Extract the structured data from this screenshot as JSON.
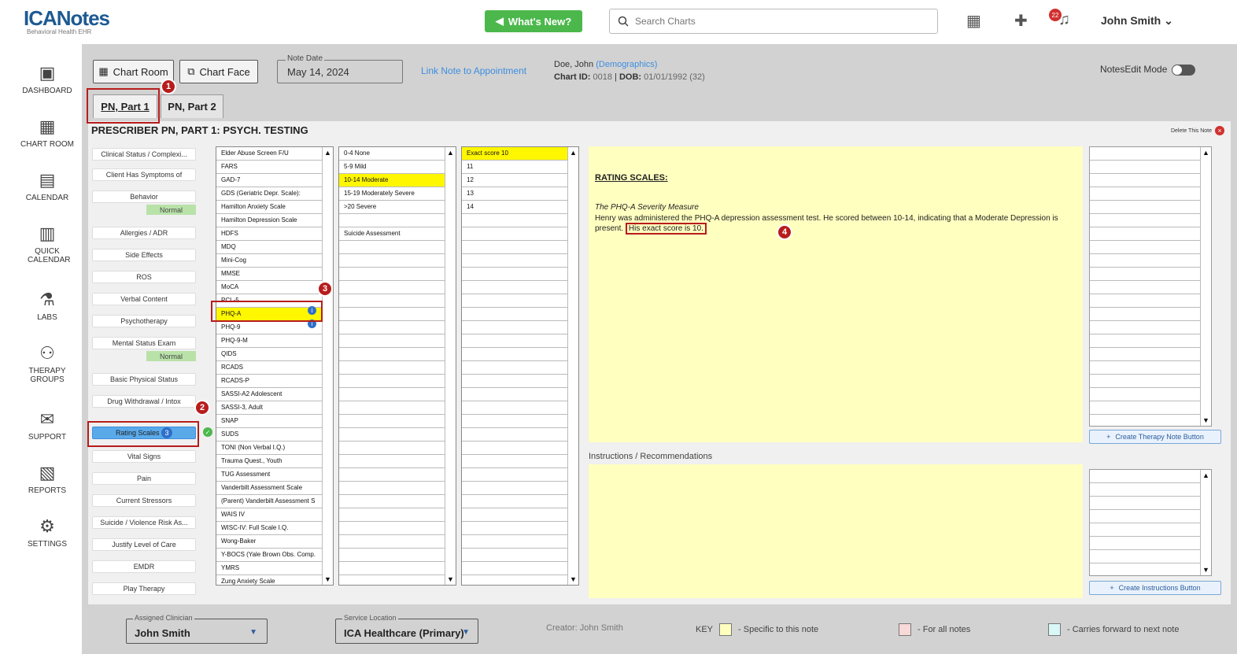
{
  "app": {
    "brand": "ICANotes",
    "subtitle": "Behavioral Health EHR"
  },
  "topbar": {
    "whats_new": "What's New?",
    "search_placeholder": "Search Charts",
    "notification_count": "22",
    "user_name": "John Smith"
  },
  "nav": [
    {
      "label": "DASHBOARD",
      "icon": "dashboard-icon"
    },
    {
      "label": "CHART ROOM",
      "icon": "chart-room-icon"
    },
    {
      "label": "CALENDAR",
      "icon": "calendar-icon"
    },
    {
      "label": "QUICK CALENDAR",
      "icon": "quick-calendar-icon"
    },
    {
      "label": "LABS",
      "icon": "flask-icon"
    },
    {
      "label": "THERAPY GROUPS",
      "icon": "group-icon"
    },
    {
      "label": "SUPPORT",
      "icon": "support-icon"
    },
    {
      "label": "REPORTS",
      "icon": "reports-icon"
    },
    {
      "label": "SETTINGS",
      "icon": "gear-icon"
    }
  ],
  "header": {
    "chart_room": "Chart Room",
    "chart_face": "Chart Face",
    "note_date_label": "Note Date",
    "note_date": "May 14, 2024",
    "link_note": "Link Note to Appointment",
    "patient_name": "Doe, John",
    "demographics": "(Demographics)",
    "chart_id_label": "Chart ID:",
    "chart_id": "0018",
    "dob_label": "DOB:",
    "dob": "01/01/1992 (32)",
    "notes_edit_mode": "NotesEdit Mode"
  },
  "tabs": [
    "PN, Part 1",
    "PN, Part 2"
  ],
  "panel": {
    "title": "PRESCRIBER PN, PART 1: PSYCH. TESTING",
    "delete_note": "Delete This Note"
  },
  "sections": [
    "Clinical Status / Complexi...",
    "Client Has Symptoms of",
    "Behavior",
    "Allergies / ADR",
    "Side Effects",
    "ROS",
    "Verbal Content",
    "Psychotherapy",
    "Mental Status Exam",
    "Basic Physical Status",
    "Drug Withdrawal / Intox",
    "Rating Scales",
    "Vital Signs",
    "Pain",
    "Current Stressors",
    "Suicide / Violence Risk As...",
    "Justify Level of Care",
    "EMDR",
    "Play Therapy"
  ],
  "normal_label": "Normal",
  "rating_badge": "3",
  "scales": [
    "Elder Abuse Screen F/U",
    "FARS",
    "GAD-7",
    "GDS (Geriatric Depr. Scale):",
    "Hamilton Anxiety Scale",
    "Hamilton Depression Scale",
    "HDFS",
    "MDQ",
    "Mini-Cog",
    "MMSE",
    "MoCA",
    "PCL-5",
    "PHQ-A",
    "PHQ-9",
    "PHQ-9-M",
    "QIDS",
    "RCADS",
    "RCADS-P",
    "SASSI-A2 Adolescent",
    "SASSI-3, Adult",
    "SNAP",
    "SUDS",
    "TONI (Non Verbal I.Q.)",
    "Trauma Quest., Youth",
    "TUG Assessment",
    "Vanderbilt Assessment Scale",
    "(Parent) Vanderbilt Assessment S",
    "WAIS IV",
    "WISC-IV: Full Scale I.Q.",
    "Wong-Baker",
    "Y-BOCS (Yale Brown Obs. Comp.",
    "YMRS",
    "Zung Anxiety Scale"
  ],
  "severity": [
    "0-4 None",
    "5-9 Mild",
    "10-14 Moderate",
    "15-19 Moderately Severe",
    ">20 Severe",
    "",
    "Suicide Assessment"
  ],
  "scores": [
    "Exact score 10",
    "11",
    "12",
    "13",
    "14"
  ],
  "note": {
    "heading": "RATING SCALES:",
    "measure": "The PHQ-A Severity Measure",
    "body": "Henry was administered the PHQ-A depression assessment test. He scored between 10-14, indicating that a Moderate Depression is present.",
    "exact": "His exact score is 10."
  },
  "create_therapy": "Create Therapy Note Button",
  "instructions_label": "Instructions / Recommendations",
  "create_instructions": "Create Instructions Button",
  "footer": {
    "assigned_label": "Assigned Clinician",
    "assigned": "John Smith",
    "service_label": "Service Location",
    "service": "ICA Healthcare (Primary)",
    "creator": "Creator: John Smith",
    "key": "KEY",
    "key1": "- Specific to this note",
    "key2": "- For all notes",
    "key3": "- Carries forward to next note"
  },
  "callouts": [
    "1",
    "2",
    "3",
    "4"
  ]
}
